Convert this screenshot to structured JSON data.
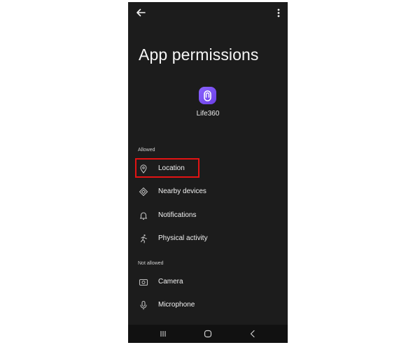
{
  "colors": {
    "background": "#1c1c1c",
    "text": "#f2f2f2",
    "app_icon": "#7c4dff",
    "highlight": "#e31313"
  },
  "header": {
    "back_icon": "arrow-left-icon",
    "more_icon": "more-vertical-icon",
    "title": "App permissions"
  },
  "app": {
    "icon": "life360-icon",
    "name": "Life360"
  },
  "allowed": {
    "label": "Allowed",
    "items": [
      {
        "label": "Location",
        "icon": "location-pin-icon"
      },
      {
        "label": "Nearby devices",
        "icon": "nearby-devices-icon"
      },
      {
        "label": "Notifications",
        "icon": "bell-icon"
      },
      {
        "label": "Physical activity",
        "icon": "activity-icon"
      }
    ]
  },
  "not_allowed": {
    "label": "Not allowed",
    "items": [
      {
        "label": "Camera",
        "icon": "camera-icon"
      },
      {
        "label": "Microphone",
        "icon": "microphone-icon"
      }
    ]
  },
  "navbar": {
    "recents_icon": "recents-icon",
    "home_icon": "home-icon",
    "back_icon": "back-chevron-icon"
  }
}
